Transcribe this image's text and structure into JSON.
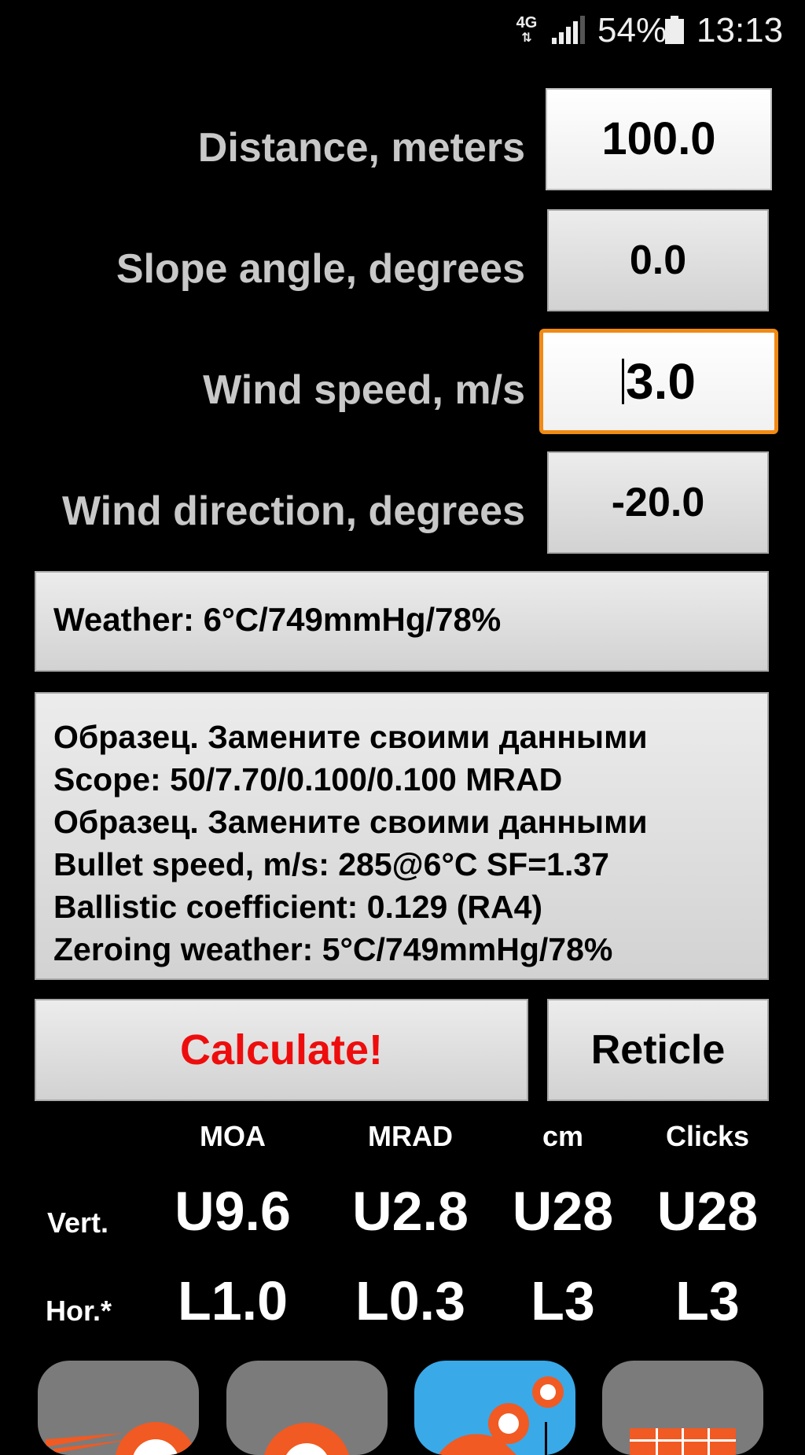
{
  "status_bar": {
    "network": "4G",
    "battery_percent": "54%",
    "time": "13:13"
  },
  "inputs": [
    {
      "label": "Distance, meters",
      "value": "100.0"
    },
    {
      "label": "Slope angle, degrees",
      "value": "0.0"
    },
    {
      "label": "Wind speed, m/s",
      "value": "3.0"
    },
    {
      "label": "Wind direction, degrees",
      "value": "-20.0"
    }
  ],
  "weather": "Weather: 6°C/749mmHg/78%",
  "info_lines": [
    "Образец. Замените своими данными",
    "Scope: 50/7.70/0.100/0.100 MRAD",
    "Образец. Замените своими данными",
    "Bullet speed, m/s: 285@6°C SF=1.37",
    "Ballistic coefficient: 0.129 (RA4)",
    "Zeroing weather: 5°C/749mmHg/78%"
  ],
  "buttons": {
    "calculate": "Calculate!",
    "reticle": "Reticle"
  },
  "results": {
    "columns": [
      "MOA",
      "MRAD",
      "cm",
      "Clicks"
    ],
    "rows": [
      {
        "label": "Vert.",
        "values": [
          "U9.6",
          "U2.8",
          "U28",
          "U28"
        ]
      },
      {
        "label": "Hor.*",
        "values": [
          "L1.0",
          "L0.3",
          "L3",
          "L3"
        ]
      }
    ]
  },
  "colors": {
    "background": "#000000",
    "focus_border": "#f08a14",
    "calculate_text": "#ee0d0d",
    "label_text": "#c8c8c8"
  },
  "bottom_apps": [
    "app-icon-ballistics",
    "app-icon-target",
    "app-icon-map",
    "app-icon-table"
  ]
}
